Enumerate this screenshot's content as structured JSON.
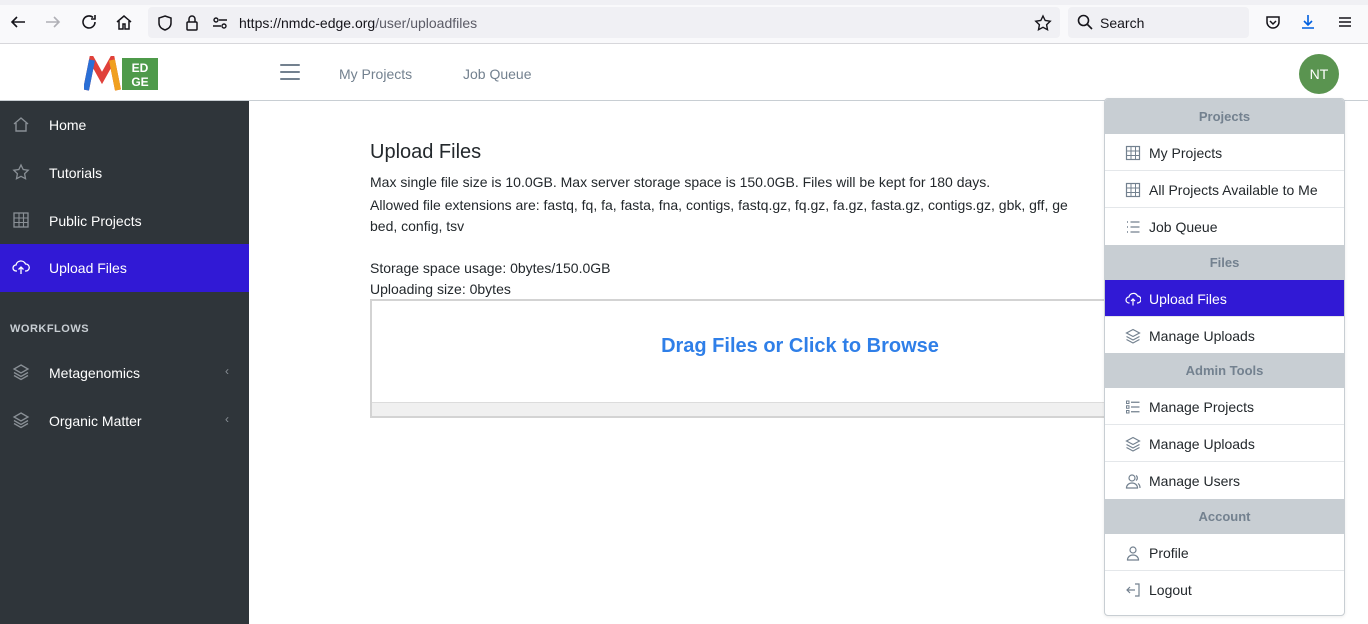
{
  "browser": {
    "url_host": "https://nmdc-edge.org",
    "url_path": "/user/uploadfiles",
    "search_label": "Search"
  },
  "header": {
    "links": [
      "My Projects",
      "Job Queue"
    ],
    "avatar_initials": "NT",
    "logo_text": "EDGE"
  },
  "sidebar": {
    "items": [
      {
        "label": "Home",
        "icon": "home-icon"
      },
      {
        "label": "Tutorials",
        "icon": "star-icon"
      },
      {
        "label": "Public Projects",
        "icon": "grid-icon"
      },
      {
        "label": "Upload Files",
        "icon": "cloud-upload-icon",
        "active": true
      }
    ],
    "section_title": "WORKFLOWS",
    "workflows": [
      {
        "label": "Metagenomics",
        "icon": "layers-icon"
      },
      {
        "label": "Organic Matter",
        "icon": "layers-icon"
      }
    ],
    "colors": {
      "background": "#2f353a",
      "active": "#3119d5"
    }
  },
  "main": {
    "title": "Upload Files",
    "line1": "Max single file size is 10.0GB. Max server storage space is 150.0GB. Files will be kept for 180 days.",
    "line2": "Allowed file extensions are: fastq, fq, fa, fasta, fna, contigs, fastq.gz, fq.gz, fa.gz, fasta.gz, contigs.gz, gbk, gff, ge",
    "line3": "bed, config, tsv",
    "storage": "Storage space usage: 0bytes/150.0GB",
    "uploading": "Uploading size: 0bytes",
    "drop_label": "Drag Files or Click to Browse"
  },
  "dropdown": {
    "projects_header": "Projects",
    "my_projects": "My Projects",
    "all_projects": "All Projects Available to Me",
    "job_queue": "Job Queue",
    "files_header": "Files",
    "upload_files": "Upload Files",
    "manage_uploads": "Manage Uploads",
    "admin_header": "Admin Tools",
    "manage_projects": "Manage Projects",
    "admin_manage_uploads": "Manage Uploads",
    "manage_users": "Manage Users",
    "account_header": "Account",
    "profile": "Profile",
    "logout": "Logout"
  }
}
